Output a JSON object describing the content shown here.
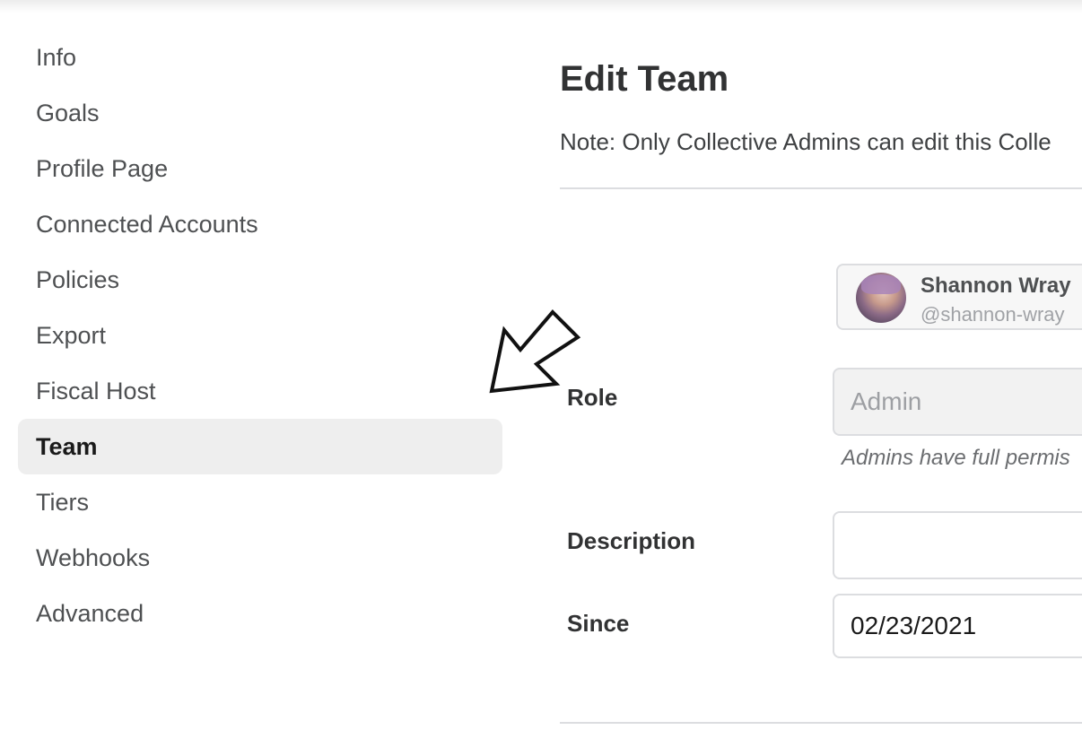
{
  "sidebar": {
    "items": [
      {
        "label": "Info",
        "active": false
      },
      {
        "label": "Goals",
        "active": false
      },
      {
        "label": "Profile Page",
        "active": false
      },
      {
        "label": "Connected Accounts",
        "active": false
      },
      {
        "label": "Policies",
        "active": false
      },
      {
        "label": "Export",
        "active": false
      },
      {
        "label": "Fiscal Host",
        "active": false
      },
      {
        "label": "Team",
        "active": true
      },
      {
        "label": "Tiers",
        "active": false
      },
      {
        "label": "Webhooks",
        "active": false
      },
      {
        "label": "Advanced",
        "active": false
      }
    ]
  },
  "main": {
    "title": "Edit Team",
    "note": "Note: Only Collective Admins can edit this Colle",
    "member": {
      "name": "Shannon Wray",
      "handle": "@shannon-wray"
    },
    "form": {
      "role_label": "Role",
      "role_value": "Admin",
      "role_help": "Admins have full permis",
      "description_label": "Description",
      "description_value": "",
      "since_label": "Since",
      "since_value": "02/23/2021"
    }
  },
  "colors": {
    "active_item_bg": "#eeeeee",
    "text_primary": "#313233",
    "border": "#dcdde0"
  },
  "icons": {
    "annotation": "arrow-pointer-icon",
    "avatar": "user-avatar"
  }
}
